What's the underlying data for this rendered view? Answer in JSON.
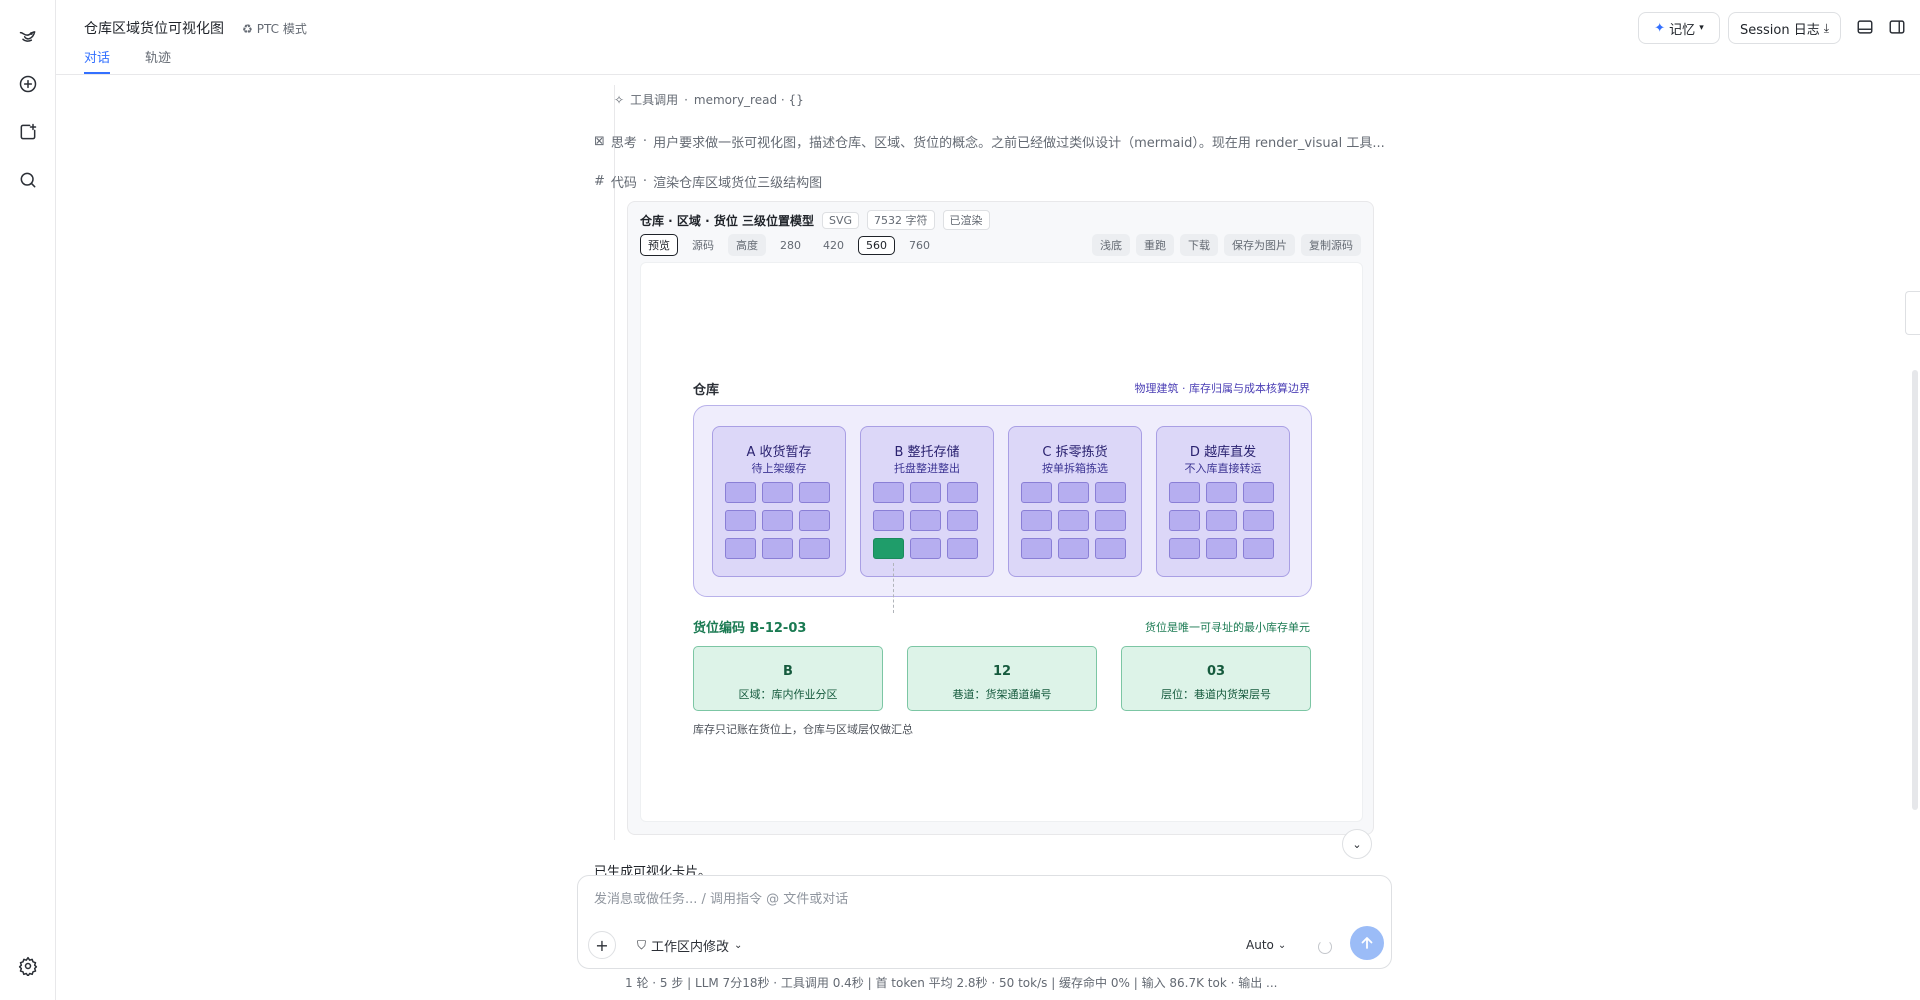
{
  "header": {
    "title": "仓库区域货位可视化图",
    "ptc_label": "PTC 模式",
    "tabs": [
      "对话",
      "轨迹"
    ],
    "memory_label": "记忆",
    "session_label": "Session 日志"
  },
  "messages": {
    "tool_call_label": "工具调用",
    "tool_call_detail": "memory_read · {}",
    "thought_label": "思考",
    "thought_text": "用户要求做一张可视化图，描述仓库、区域、货位的概念。之前已经做过类似设计（mermaid）。现在用 render_visual 工具...",
    "code_label": "代码",
    "code_text": "渲染仓库区域货位三级结构图",
    "result_text": "已生成可视化卡片。"
  },
  "card": {
    "title": "仓库 · 区域 · 货位 三级位置模型",
    "chips": [
      "SVG",
      "7532 字符",
      "已渲染"
    ],
    "view_tabs": [
      "预览",
      "源码"
    ],
    "height_label": "高度",
    "heights": [
      "280",
      "420",
      "560",
      "760"
    ],
    "selected_height": "560",
    "actions": [
      "浅底",
      "重跑",
      "下载",
      "保存为图片",
      "复制源码"
    ]
  },
  "diagram": {
    "warehouse_label": "仓库",
    "warehouse_note": "物理建筑 · 库存归属与成本核算边界",
    "zones": [
      {
        "title": "A 收货暂存",
        "sub": "待上架缓存"
      },
      {
        "title": "B 整托存储",
        "sub": "托盘整进整出"
      },
      {
        "title": "C 拆零拣货",
        "sub": "按单拆箱拣选"
      },
      {
        "title": "D 越库直发",
        "sub": "不入库直接转运"
      }
    ],
    "code_label": "货位编码 B-12-03",
    "code_note": "货位是唯一可寻址的最小库存单元",
    "segments": [
      {
        "value": "B",
        "desc": "区域：库内作业分区"
      },
      {
        "value": "12",
        "desc": "巷道：货架通道编号"
      },
      {
        "value": "03",
        "desc": "层位：巷道内货架层号"
      }
    ],
    "footnote": "库存只记账在货位上，仓库与区域层仅做汇总"
  },
  "composer": {
    "placeholder": "发消息或做任务... / 调用指令 @ 文件或对话",
    "scope_label": "工作区内修改",
    "mode_label": "Auto"
  },
  "stats": "1 轮 · 5 步   |   LLM 7分18秒 · 工具调用 0.4秒   |   首 token 平均 2.8秒 · 50 tok/s   |   缓存命中 0%   |   输入 86.7K tok · 输出 ..."
}
